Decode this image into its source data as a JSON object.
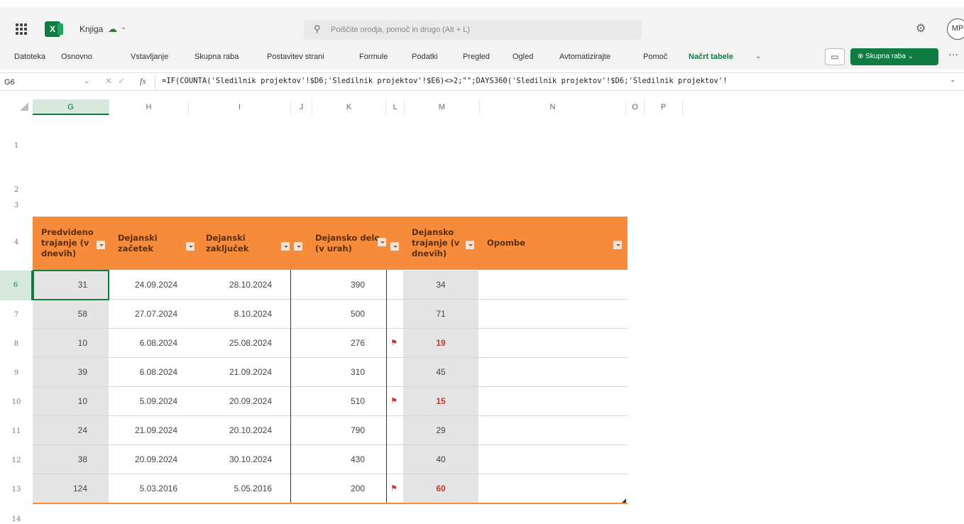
{
  "app": {
    "doc_title": "Knjiga",
    "search_placeholder": "Poiščite orodja, pomoč in drugo (Alt + L)",
    "avatar_initials": "MP"
  },
  "ribbon": {
    "tabs": [
      {
        "label": "Datoteka",
        "active": false
      },
      {
        "label": "Osnovno",
        "active": false
      },
      {
        "label": "Vstavljanje",
        "active": false
      },
      {
        "label": "Skupna raba",
        "active": false
      },
      {
        "label": "Postavitev strani",
        "active": false
      },
      {
        "label": "Formule",
        "active": false
      },
      {
        "label": "Podatki",
        "active": false
      },
      {
        "label": "Pregled",
        "active": false
      },
      {
        "label": "Ogled",
        "active": false
      },
      {
        "label": "Avtomatizirajte",
        "active": false
      },
      {
        "label": "Pomoč",
        "active": false
      },
      {
        "label": "Načrt tabele",
        "active": true
      }
    ],
    "share_label": "Skupna raba",
    "more_label": "···"
  },
  "formula_bar": {
    "name_box": "G6",
    "fx": "fx",
    "formula": "=IF(COUNTA('Sledilnik projektov'!$D6;'Sledilnik projektov'!$E6)<>2;\"\";DAYS360('Sledilnik projektov'!$D6;'Sledilnik projektov'!"
  },
  "columns": [
    "G",
    "H",
    "I",
    "J",
    "K",
    "L",
    "M",
    "N",
    "O",
    "P"
  ],
  "row_numbers": [
    "1",
    "2",
    "3",
    "4",
    "6",
    "7",
    "8",
    "9",
    "10",
    "11",
    "12",
    "13",
    "14"
  ],
  "table": {
    "headers": {
      "g": "Predvideno trajanje (v dnevih)",
      "h": "Dejanski začetek",
      "i": "Dejanski zaključek",
      "k": "Dejansko delo (v urah)",
      "m": "Dejansko trajanje (v dnevih)",
      "n": "Opombe"
    },
    "rows": [
      {
        "g": "31",
        "h": "24.09.2024",
        "i": "28.10.2024",
        "k": "390",
        "flag": false,
        "m": "34",
        "m_red": false
      },
      {
        "g": "58",
        "h": "27.07.2024",
        "i": "8.10.2024",
        "k": "500",
        "flag": false,
        "m": "71",
        "m_red": false
      },
      {
        "g": "10",
        "h": "6.08.2024",
        "i": "25.08.2024",
        "k": "276",
        "flag": true,
        "m": "19",
        "m_red": true
      },
      {
        "g": "39",
        "h": "6.08.2024",
        "i": "21.09.2024",
        "k": "310",
        "flag": false,
        "m": "45",
        "m_red": false
      },
      {
        "g": "10",
        "h": "5.09.2024",
        "i": "20.09.2024",
        "k": "510",
        "flag": true,
        "m": "15",
        "m_red": true
      },
      {
        "g": "24",
        "h": "21.09.2024",
        "i": "20.10.2024",
        "k": "790",
        "flag": false,
        "m": "29",
        "m_red": false
      },
      {
        "g": "38",
        "h": "20.09.2024",
        "i": "30.10.2024",
        "k": "430",
        "flag": false,
        "m": "40",
        "m_red": false
      },
      {
        "g": "124",
        "h": "5.03.2016",
        "i": "5.05.2016",
        "k": "200",
        "flag": true,
        "m": "60",
        "m_red": true
      }
    ]
  },
  "colors": {
    "header_orange": "#f58b3b",
    "excel_green": "#107c41",
    "flag_red": "#c0392b"
  }
}
